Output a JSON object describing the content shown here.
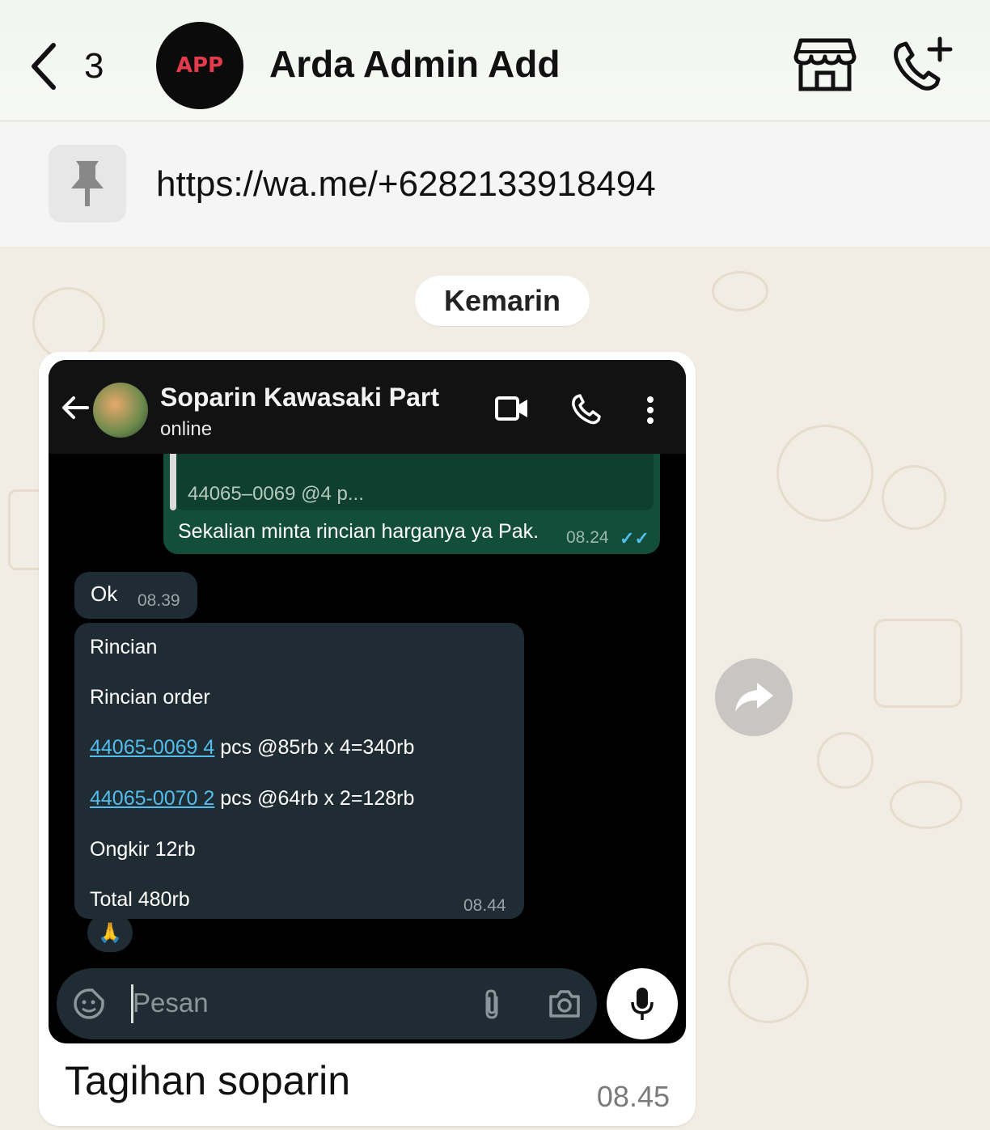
{
  "header": {
    "back_count": "3",
    "avatar_text": "APP",
    "title": "Arda Admin Add",
    "icons": [
      "chevron-left-icon",
      "store-icon",
      "add-call-icon"
    ]
  },
  "pinned": {
    "text": "https://wa.me/+6282133918494",
    "icon": "pin-icon"
  },
  "date_separator": "Kemarin",
  "message": {
    "caption": "Tagihan soparin",
    "time": "08.45",
    "screenshot": {
      "contact_name": "Soparin Kawasaki Part",
      "contact_status": "online",
      "outgoing": {
        "quote": "44065–0069 @4 p...",
        "text": "Sekalian minta rincian harganya ya Pak.",
        "time": "08.24"
      },
      "incoming_1": {
        "text": "Ok",
        "time": "08.39"
      },
      "incoming_2": {
        "line_1": "Rincian",
        "line_2": "Rincian order",
        "item_1_link": "44065-0069 4",
        "item_1_rest": " pcs @85rb x 4=340rb",
        "item_2_link": "44065-0070 2",
        "item_2_rest": " pcs @64rb x 2=128rb",
        "line_5": "Ongkir 12rb",
        "line_6": "Total 480rb",
        "time": "08.44"
      },
      "reaction": "🙏",
      "compose_placeholder": "Pesan"
    }
  },
  "colors": {
    "outgoing_bubble": "#134e3a",
    "incoming_bubble": "#1f2c33",
    "link": "#53bdeb",
    "wallpaper": "#f2ede4"
  }
}
